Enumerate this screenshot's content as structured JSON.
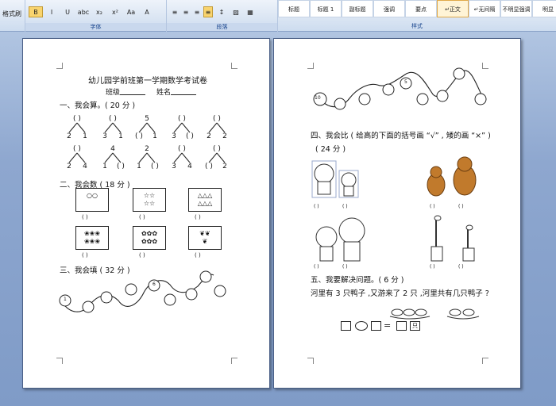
{
  "ribbon": {
    "format_painter": "格式刷",
    "font_group": "字体",
    "paragraph_group": "段落",
    "styles_group": "样式",
    "font_buttons": [
      "B",
      "I",
      "U",
      "abc",
      "x₂",
      "x²",
      "Aa",
      "A"
    ],
    "styles": [
      "标题",
      "标题 1",
      "副标题",
      "强调",
      "要点",
      "正文",
      "无间隔",
      "不明显强调",
      "明显"
    ],
    "style_prefixes": [
      "",
      "",
      "",
      "",
      "",
      "↵",
      "↵",
      "",
      ""
    ],
    "selected_style": "正文"
  },
  "left": {
    "title": "幼儿园学前班第一学期数学考试卷",
    "class_label": "班级",
    "name_label": "姓名",
    "s1": "一、我会算。( 20 分 )",
    "s2": "二、我会数 ( 18 分 )",
    "s3": "三、我会填 ( 32 分 )",
    "row1": [
      [
        "2",
        "1",
        "( )"
      ],
      [
        "3",
        "1",
        "( )"
      ],
      [
        "( )",
        "1",
        "5"
      ],
      [
        "3",
        "( )",
        "( )"
      ],
      [
        "2",
        "2",
        "( )"
      ]
    ],
    "row2": [
      [
        "2",
        "4",
        "( )"
      ],
      [
        "1",
        "( )",
        "4"
      ],
      [
        "1",
        "( )",
        "2"
      ],
      [
        "3",
        "4",
        "( )"
      ],
      [
        "( )",
        "2",
        "( )"
      ]
    ],
    "blank": "(      )",
    "box_icons": [
      "○○",
      "☆☆\n☆☆",
      "△△△\n△△△",
      "❀❀❀\n❀❀❀",
      "✿✿✿\n✿✿✿",
      "❦❦\n❦"
    ],
    "chain_start": "1",
    "chain_mid": "6"
  },
  "right": {
    "chain_start": "10",
    "chain_mid": "5",
    "s4": "四、我会比 ( 给高的下面的括号画 “√” , 矮的画 “×” )",
    "s4_score": "( 24 分 )",
    "paren": "(    )",
    "s5": "五、我要解决问题。( 6 分 )",
    "problem": "河里有 3 只鸭子 ,又游来了 2 只 ,河里共有几只鸭子 ?",
    "unit": "只"
  }
}
